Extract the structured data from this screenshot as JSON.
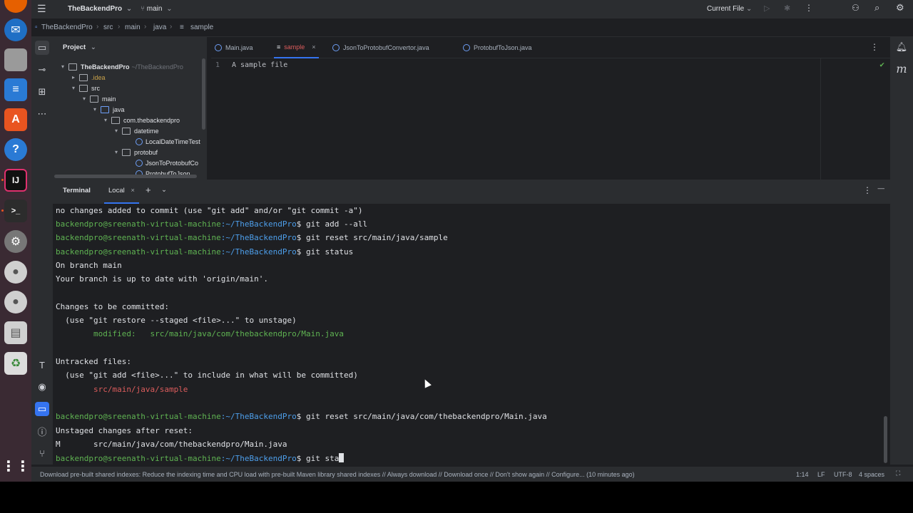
{
  "window": {
    "project_name": "TheBackendPro",
    "branch": "main",
    "run_config": "Current File"
  },
  "breadcrumb": [
    "TheBackendPro",
    "src",
    "main",
    "java",
    "sample"
  ],
  "project_panel": {
    "title": "Project",
    "tree": [
      {
        "label": "TheBackendPro",
        "path": "~/TheBackendPro"
      },
      {
        "label": ".idea"
      },
      {
        "label": "src"
      },
      {
        "label": "main"
      },
      {
        "label": "java"
      },
      {
        "label": "com.thebackendpro"
      },
      {
        "label": "datetime"
      },
      {
        "label": "LocalDateTimeTest"
      },
      {
        "label": "protobuf"
      },
      {
        "label": "JsonToProtobufCo"
      },
      {
        "label": "ProtobufToJson"
      }
    ]
  },
  "editor_tabs": [
    {
      "label": "Main.java"
    },
    {
      "label": "sample",
      "active": true
    },
    {
      "label": "JsonToProtobufConvertor.java"
    },
    {
      "label": "ProtobufToJson.java"
    }
  ],
  "editor": {
    "line_number": "1",
    "line_text": "A sample file"
  },
  "terminal": {
    "title": "Terminal",
    "tab": "Local",
    "prompt_user": "backendpro@sreenath-virtual-machine",
    "prompt_path": ":~/TheBackendPro",
    "lines": {
      "l0": "no changes added to commit (use \"git add\" and/or \"git commit -a\")",
      "c1": "$ git add --all",
      "c2": "$ git reset src/main/java/sample",
      "c3": "$ git status",
      "l4": "On branch main",
      "l5": "Your branch is up to date with 'origin/main'.",
      "l7": "Changes to be committed:",
      "l8": "  (use \"git restore --staged <file>...\" to unstage)",
      "l9": "        modified:   src/main/java/com/thebackendpro/Main.java",
      "l12": "Untracked files:",
      "l13": "  (use \"git add <file>...\" to include in what will be committed)",
      "l14": "        src/main/java/sample",
      "c16": "$ git reset src/main/java/com/thebackendpro/Main.java",
      "l17": "Unstaged changes after reset:",
      "l18": "M       src/main/java/com/thebackendpro/Main.java",
      "c19": "$ git sta"
    }
  },
  "statusbar": {
    "message": "Download pre-built shared indexes: Reduce the indexing time and CPU load with pre-built Maven library shared indexes // Always download // Download once // Don't show again // Configure... (10 minutes ago)",
    "position": "1:14",
    "line_sep": "LF",
    "encoding": "UTF-8",
    "indent": "4 spaces"
  },
  "colors": {
    "prompt_green": "#5fb352",
    "prompt_blue": "#4d9eea",
    "untracked_red": "#db5c5c",
    "ide_background": "#1e1f22",
    "panel_background": "#2b2d30"
  }
}
